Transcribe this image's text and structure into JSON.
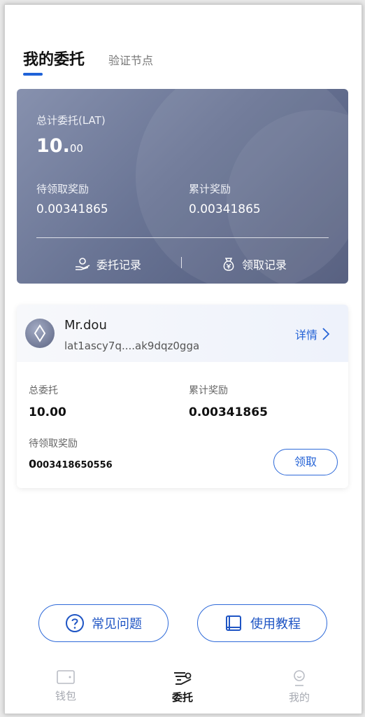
{
  "tabs": {
    "active": "我的委托",
    "inactive": "验证节点"
  },
  "summary": {
    "total_label": "总计委托(LAT)",
    "total_int": "10.",
    "total_dec": "00",
    "pending_label": "待领取奖励",
    "pending_value": "0.00341865",
    "cumulative_label": "累计奖励",
    "cumulative_value": "0.00341865",
    "delegate_record": "委托记录",
    "claim_record": "领取记录"
  },
  "node": {
    "name": "Mr.dou",
    "address": "lat1ascy7q....ak9dqz0gga",
    "detail_label": "详情",
    "total_label": "总委托",
    "total_value": "10.00",
    "cumulative_label": "累计奖励",
    "cumulative_value": "0.00341865",
    "pending_label": "待领取奖励",
    "pending_value_lead": "0",
    "pending_value_rest": "003418650556",
    "claim_button": "领取"
  },
  "help": {
    "faq": "常见问题",
    "tutorial": "使用教程"
  },
  "nav": {
    "wallet": "钱包",
    "delegate": "委托",
    "me": "我的"
  },
  "colors": {
    "accent": "#2563d6",
    "card_top": "#8791ae",
    "card_bottom": "#4e587a"
  },
  "icons": [
    "hand-coin-icon",
    "money-bag-icon",
    "diamond-icon",
    "chevron-right-icon",
    "question-icon",
    "book-icon",
    "wallet-icon",
    "delegate-icon",
    "profile-icon"
  ]
}
